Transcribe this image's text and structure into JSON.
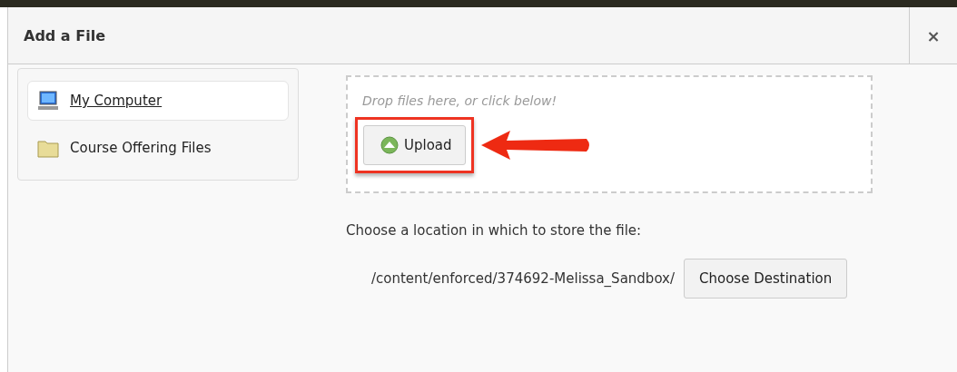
{
  "dialog": {
    "title": "Add a File",
    "close": "×"
  },
  "sources": [
    {
      "kind": "computer",
      "label": "My Computer",
      "selected": true
    },
    {
      "kind": "folder",
      "label": "Course Offering Files",
      "selected": false
    }
  ],
  "drop_zone": {
    "hint": "Drop files here, or click below!",
    "button": "Upload",
    "highlighted": true
  },
  "destination": {
    "label": "Choose a location in which to store the file:",
    "path": "/content/enforced/374692-Melissa_Sandbox/",
    "button": "Choose Destination"
  }
}
